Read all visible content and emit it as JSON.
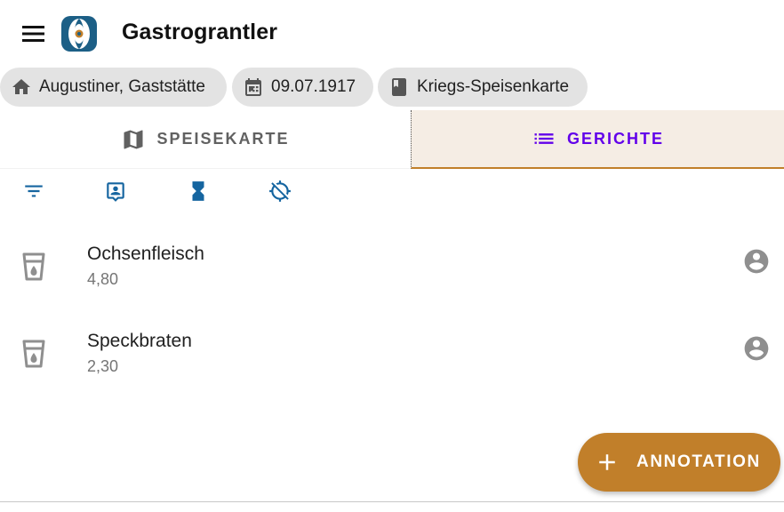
{
  "appbar": {
    "title": "Gastrograntler",
    "menu_icon": "menu-icon",
    "logo_icon": "app-logo"
  },
  "chips": [
    {
      "icon": "home-icon",
      "label": "Augustiner, Gaststätte"
    },
    {
      "icon": "calendar-icon",
      "label": "09.07.1917"
    },
    {
      "icon": "book-icon",
      "label": "Kriegs-Speisenkarte"
    }
  ],
  "tabs": [
    {
      "icon": "map-icon",
      "label": "SPEISEKARTE",
      "active": false
    },
    {
      "icon": "list-icon",
      "label": "GERICHTE",
      "active": true
    }
  ],
  "toolbar": {
    "icons": [
      "filter-icon",
      "badge-icon",
      "hourglass-icon",
      "gps-off-icon"
    ]
  },
  "dishes": [
    {
      "name": "Ochsenfleisch",
      "price": "4,80"
    },
    {
      "name": "Speckbraten",
      "price": "2,30"
    }
  ],
  "fab": {
    "label": "ANNOTATION",
    "icon": "plus-icon"
  },
  "colors": {
    "accent": "#c17f2a",
    "active_tab_text": "#6200ea",
    "active_tab_bg": "#f5ede4",
    "toolbar_icon": "#1565a0",
    "chip_bg": "#e3e3e3"
  }
}
